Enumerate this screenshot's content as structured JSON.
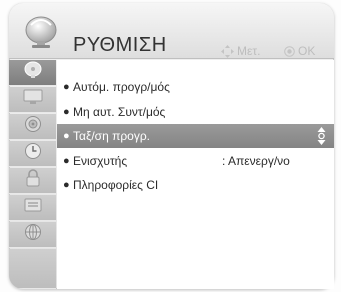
{
  "header": {
    "title": "ΡΥΘΜΙΣΗ",
    "hint_move_label": "Μετ.",
    "hint_ok_label": "OK",
    "icon": "tv-setup-icon"
  },
  "sidebar": {
    "items": [
      {
        "icon": "satellite-dish-icon",
        "active": true
      },
      {
        "icon": "picture-icon",
        "active": false
      },
      {
        "icon": "audio-icon",
        "active": false
      },
      {
        "icon": "clock-icon",
        "active": false
      },
      {
        "icon": "lock-icon",
        "active": false
      },
      {
        "icon": "options-icon",
        "active": false
      },
      {
        "icon": "network-icon",
        "active": false
      }
    ]
  },
  "menu": {
    "items": [
      {
        "label": "Αυτόμ. προγρ/μός",
        "value": ""
      },
      {
        "label": "Μη αυτ. Συντ/μός",
        "value": ""
      },
      {
        "label": "Ταξ/ση προγρ.",
        "value": "",
        "selected": true
      },
      {
        "label": "Ενισχυτής",
        "value": ": Απενεργ/νο"
      },
      {
        "label": "Πληροφορίες CI",
        "value": ""
      }
    ]
  },
  "colors": {
    "selected_row": "#8e8e8e",
    "active_tab": "#8a8a8a",
    "hint_text": "#bdbdbd"
  }
}
